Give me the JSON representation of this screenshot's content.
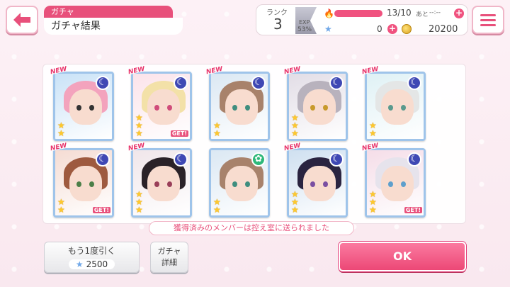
{
  "header": {
    "category": "ガチャ",
    "title": "ガチャ結果"
  },
  "status": {
    "rank_label": "ランク",
    "rank": "3",
    "exp_label": "EXP",
    "exp_percent": "53%",
    "stamina": "13/10",
    "stamina_fraction": 1.0,
    "stamina_suffix": "あと",
    "stamina_timer": "--:--",
    "star_gems": "0",
    "coins": "20200"
  },
  "cards": [
    {
      "new": true,
      "attr": "moon",
      "stars": 2,
      "get": false,
      "hair": "#f3a3bd",
      "eye": "#333",
      "bg": "#c9e2f7"
    },
    {
      "new": true,
      "attr": "moon",
      "stars": 3,
      "get": true,
      "hair": "#f3e1a8",
      "eye": "#d04c7a",
      "bg": "#fbe3ea"
    },
    {
      "new": true,
      "attr": "moon",
      "stars": 2,
      "get": false,
      "hair": "#a8826b",
      "eye": "#3f8e7f",
      "bg": "#dbe8f3"
    },
    {
      "new": true,
      "attr": "moon",
      "stars": 3,
      "get": false,
      "hair": "#b8b2bd",
      "eye": "#c89a2c",
      "bg": "#e2dde6"
    },
    {
      "new": true,
      "attr": "moon",
      "stars": 2,
      "get": false,
      "hair": "#e4e6e6",
      "eye": "#5a9a8e",
      "bg": "#dff1f5"
    },
    {
      "new": true,
      "attr": "moon",
      "stars": 2,
      "get": true,
      "hair": "#9e5a3f",
      "eye": "#4c7f48",
      "bg": "#f5dcd3"
    },
    {
      "new": true,
      "attr": "moon",
      "stars": 3,
      "get": false,
      "hair": "#2a2228",
      "eye": "#9a3f59",
      "bg": "#f0e6ea"
    },
    {
      "new": false,
      "attr": "flower",
      "stars": 2,
      "get": false,
      "hair": "#a8826b",
      "eye": "#3f8e7f",
      "bg": "#dbe8f3"
    },
    {
      "new": true,
      "attr": "moon",
      "stars": 3,
      "get": false,
      "hair": "#2a2440",
      "eye": "#7a4fa2",
      "bg": "#cfe0f0"
    },
    {
      "new": true,
      "attr": "moon",
      "stars": 3,
      "get": true,
      "hair": "#e6e3ec",
      "eye": "#5e9fcc",
      "bg": "#f5dde8"
    }
  ],
  "new_label": "NEW",
  "get_label": "GET!",
  "notice": "獲得済みのメンバーは控え室に送られました",
  "buttons": {
    "redraw": "もう1度引く",
    "redraw_cost": "2500",
    "detail_line1": "ガチャ",
    "detail_line2": "詳細",
    "ok": "OK"
  },
  "colors": {
    "accent": "#e8507b",
    "card_border": "#9fc4ea",
    "star": "#ffc92b"
  }
}
